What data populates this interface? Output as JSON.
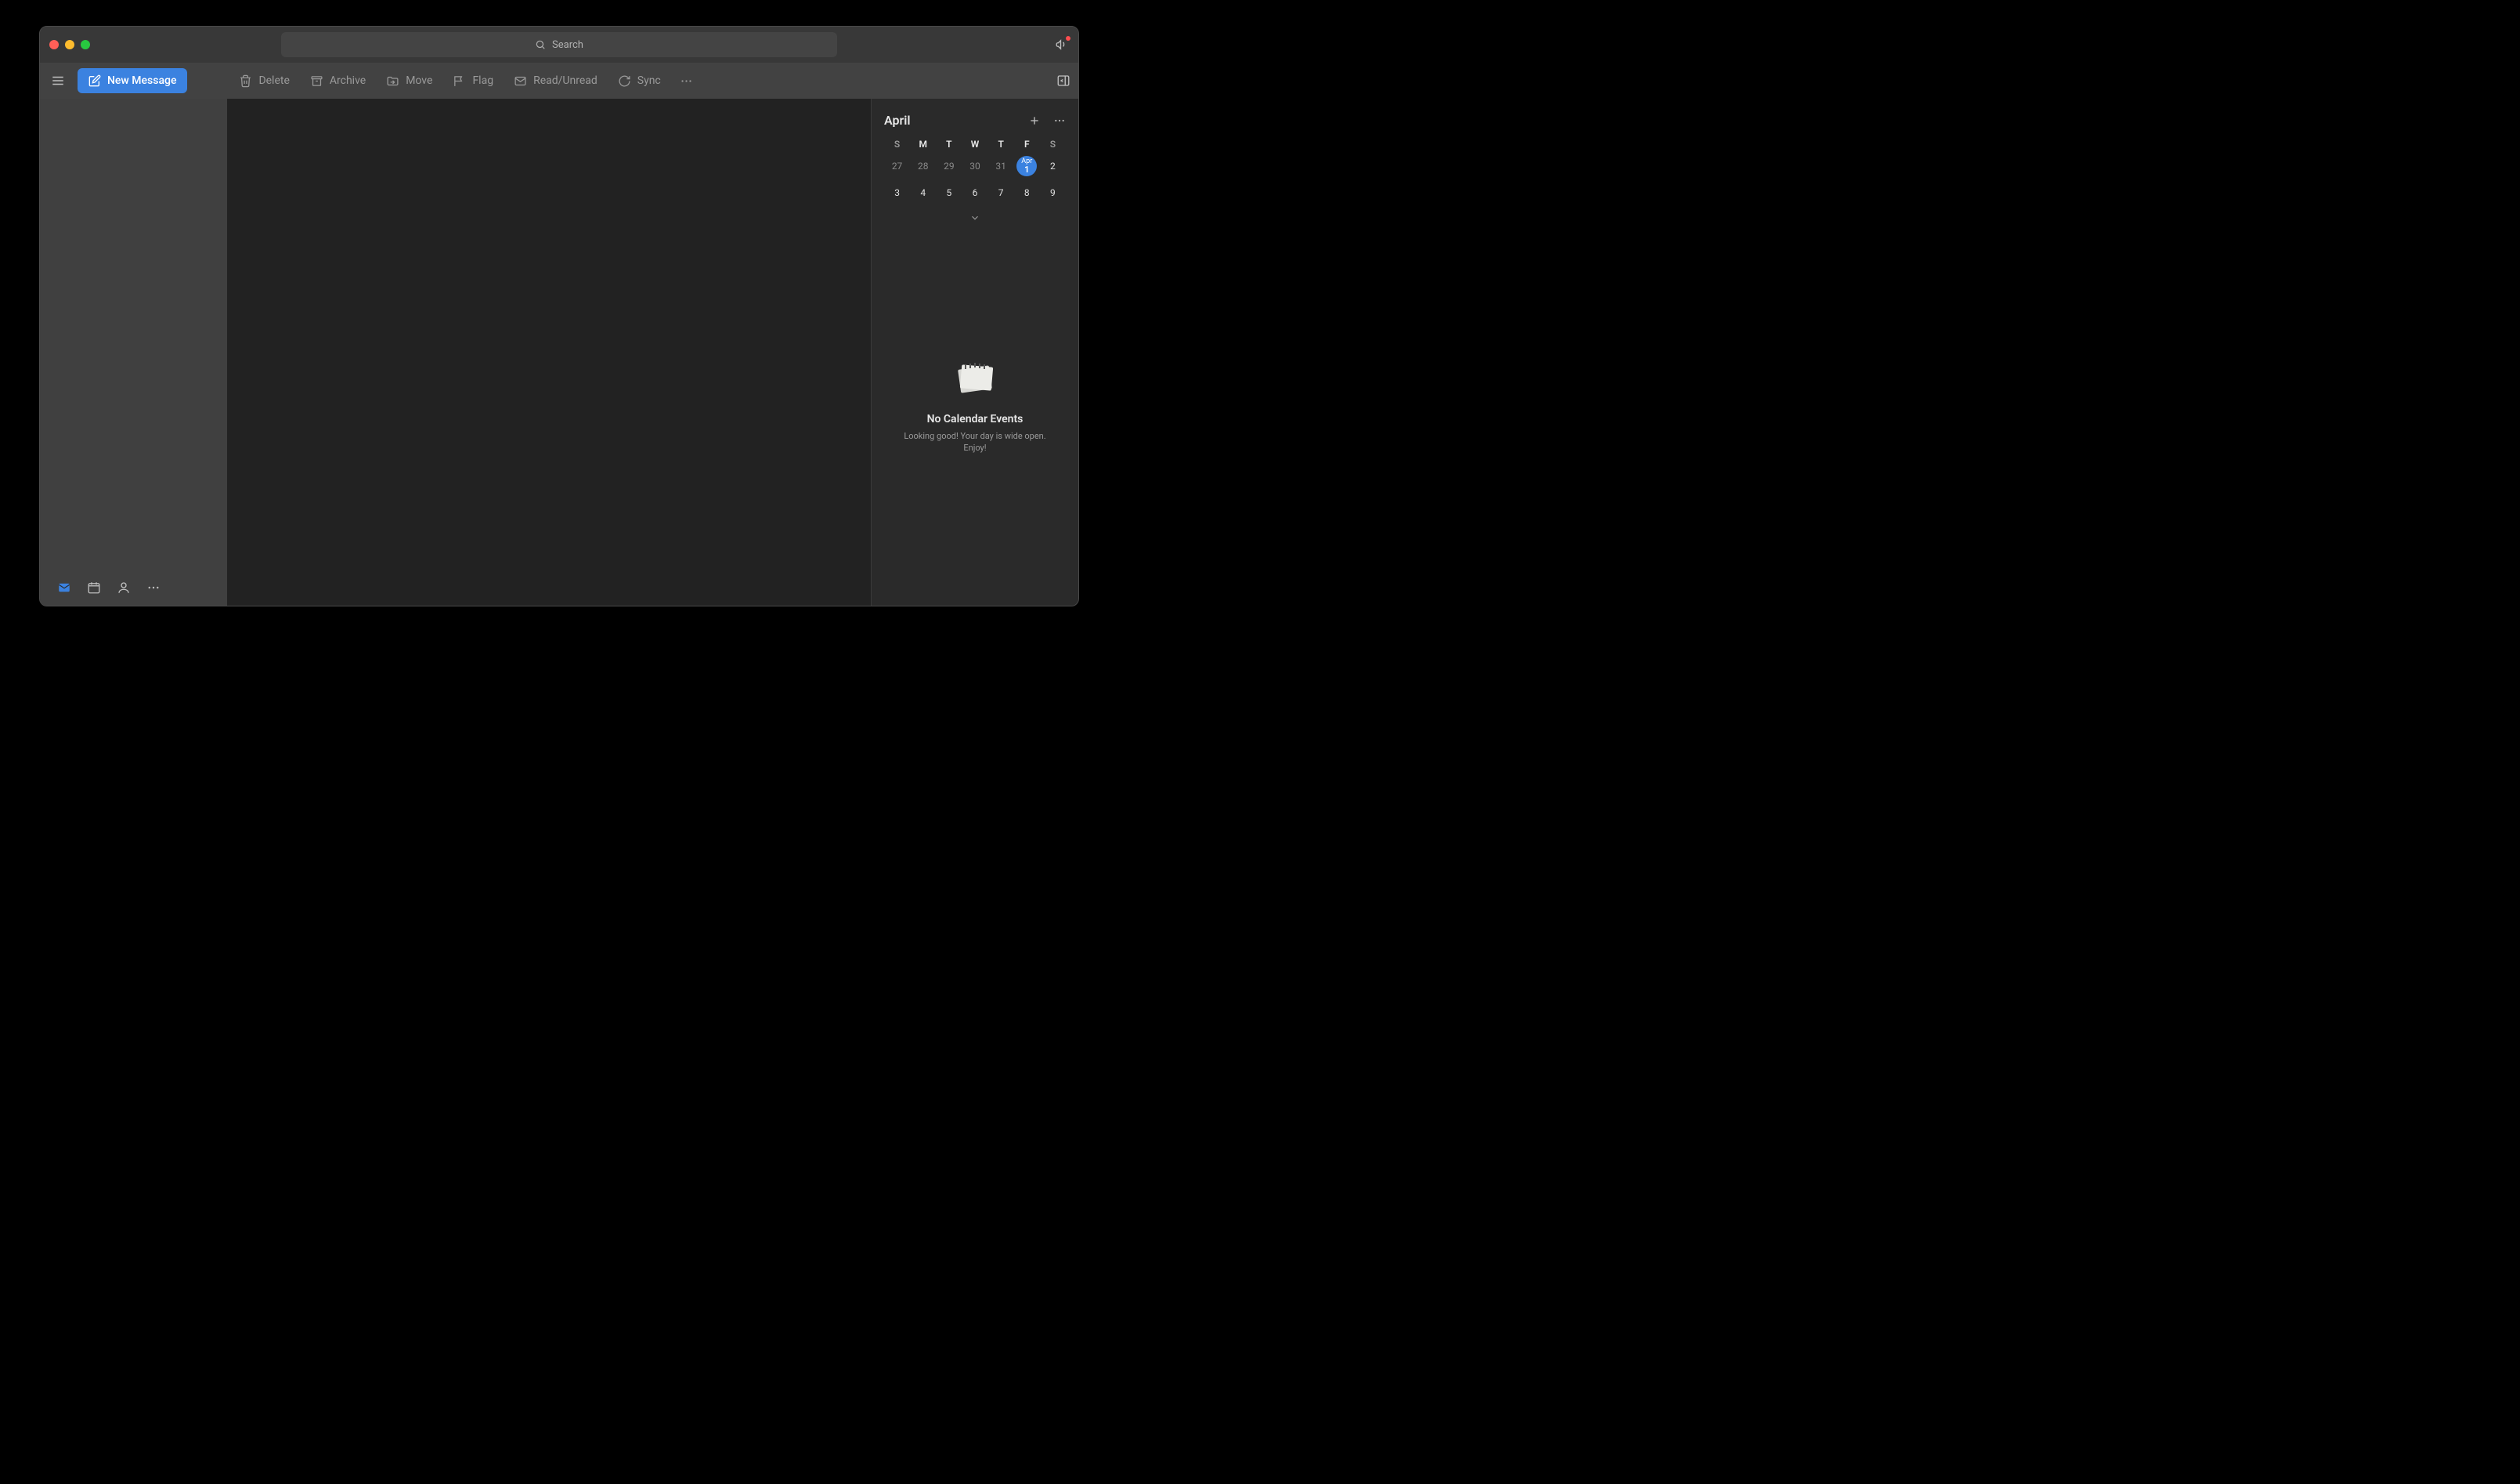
{
  "titlebar": {
    "search_placeholder": "Search"
  },
  "toolbar": {
    "new_message": "New Message",
    "delete": "Delete",
    "archive": "Archive",
    "move": "Move",
    "flag": "Flag",
    "read_unread": "Read/Unread",
    "sync": "Sync"
  },
  "calendar": {
    "month": "April",
    "dow": [
      "S",
      "M",
      "T",
      "W",
      "T",
      "F",
      "S"
    ],
    "rows": [
      [
        {
          "d": "27",
          "other": true
        },
        {
          "d": "28",
          "other": true
        },
        {
          "d": "29",
          "other": true
        },
        {
          "d": "30",
          "other": true
        },
        {
          "d": "31",
          "other": true
        },
        {
          "d": "1",
          "today": true,
          "today_label": "Apr"
        },
        {
          "d": "2"
        }
      ],
      [
        {
          "d": "3"
        },
        {
          "d": "4"
        },
        {
          "d": "5"
        },
        {
          "d": "6"
        },
        {
          "d": "7"
        },
        {
          "d": "8"
        },
        {
          "d": "9"
        }
      ]
    ],
    "empty_title": "No Calendar Events",
    "empty_sub": "Looking good! Your day is wide open. Enjoy!"
  }
}
